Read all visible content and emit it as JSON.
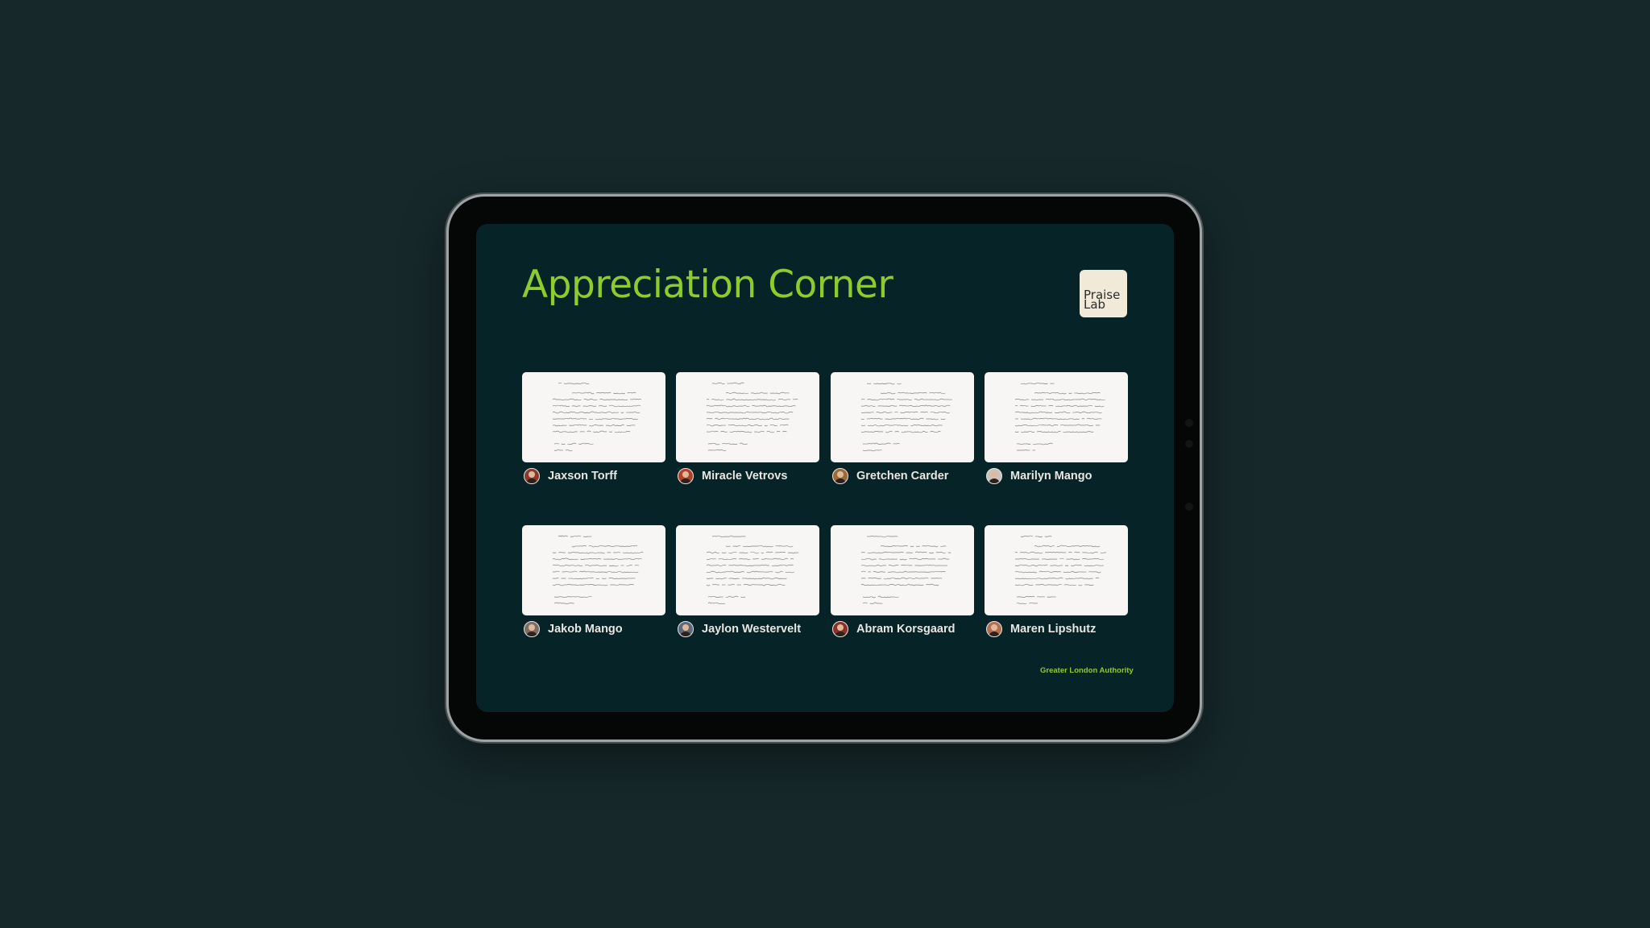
{
  "page": {
    "title": "Appreciation Corner",
    "logo": {
      "line1": "Praise",
      "line2": "Lab"
    },
    "footer": "Greater London Authority",
    "accent_color": "#8ecb2d",
    "screen_background": "#062427",
    "page_background": "#16282a"
  },
  "cards": [
    {
      "name": "Jaxson Torff",
      "avatar_icon": "person-avatar-icon",
      "avatar_color": "#8a3a2b"
    },
    {
      "name": "Miracle Vetrovs",
      "avatar_icon": "person-avatar-icon",
      "avatar_color": "#b0402a"
    },
    {
      "name": "Gretchen Carder",
      "avatar_icon": "person-avatar-icon",
      "avatar_color": "#9a6a3a"
    },
    {
      "name": "Marilyn Mango",
      "avatar_icon": "person-avatar-icon",
      "avatar_color": "#c9c4bd"
    },
    {
      "name": "Jakob Mango",
      "avatar_icon": "person-avatar-icon",
      "avatar_color": "#7b6d67"
    },
    {
      "name": "Jaylon Westervelt",
      "avatar_icon": "person-avatar-icon",
      "avatar_color": "#5a6a7a"
    },
    {
      "name": "Abram Korsgaard",
      "avatar_icon": "person-avatar-icon",
      "avatar_color": "#8b2f2a"
    },
    {
      "name": "Maren Lipshutz",
      "avatar_icon": "person-avatar-icon",
      "avatar_color": "#b46e52"
    }
  ]
}
